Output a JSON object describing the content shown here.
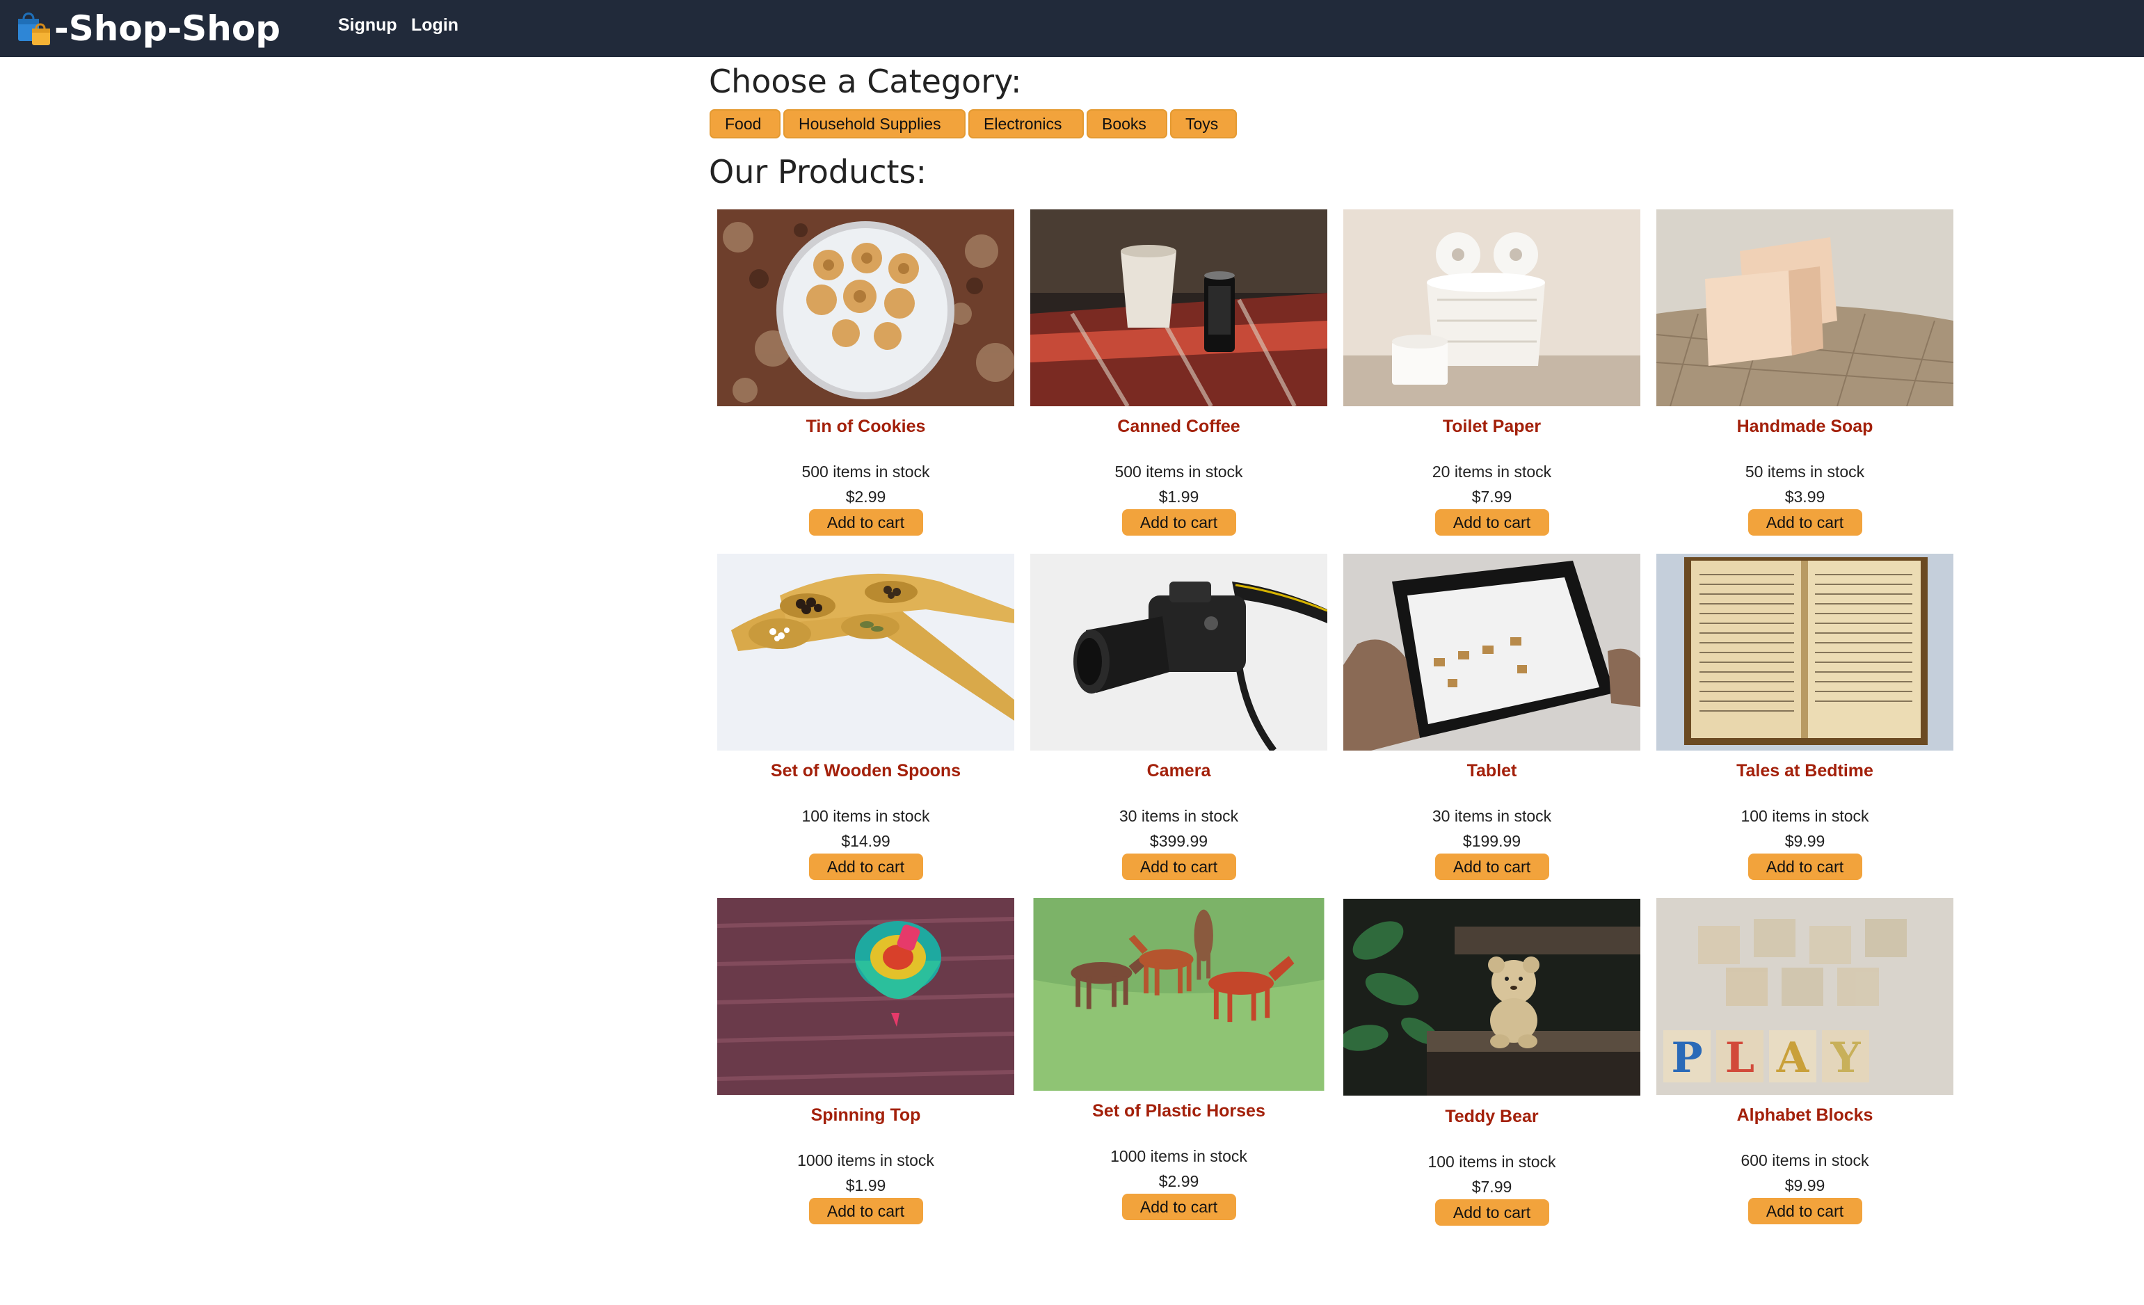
{
  "brand": {
    "name": "-Shop-Shop",
    "icon": "shopping-bags-icon"
  },
  "nav": {
    "signup": "Signup",
    "login": "Login"
  },
  "headings": {
    "categories": "Choose a Category:",
    "products": "Our Products:"
  },
  "categories": [
    "Food",
    "Household Supplies",
    "Electronics",
    "Books",
    "Toys"
  ],
  "colors": {
    "navbar": "#212a3a",
    "accent": "#f2a33c",
    "product_name": "#a3200a"
  },
  "add_to_cart_label": "Add to cart",
  "products": [
    {
      "name": "Tin of Cookies",
      "stock": "500 items in stock",
      "price": "$2.99",
      "image": "cookie-tin-photo"
    },
    {
      "name": "Canned Coffee",
      "stock": "500 items in stock",
      "price": "$1.99",
      "image": "canned-coffee-photo"
    },
    {
      "name": "Toilet Paper",
      "stock": "20 items in stock",
      "price": "$7.99",
      "image": "toilet-paper-photo"
    },
    {
      "name": "Handmade Soap",
      "stock": "50 items in stock",
      "price": "$3.99",
      "image": "soap-photo"
    },
    {
      "name": "Set of Wooden Spoons",
      "stock": "100 items in stock",
      "price": "$14.99",
      "image": "wooden-spoons-photo"
    },
    {
      "name": "Camera",
      "stock": "30 items in stock",
      "price": "$399.99",
      "image": "camera-photo"
    },
    {
      "name": "Tablet",
      "stock": "30 items in stock",
      "price": "$199.99",
      "image": "tablet-photo"
    },
    {
      "name": "Tales at Bedtime",
      "stock": "100 items in stock",
      "price": "$9.99",
      "image": "open-book-photo"
    },
    {
      "name": "Spinning Top",
      "stock": "1000 items in stock",
      "price": "$1.99",
      "image": "spinning-top-photo"
    },
    {
      "name": "Set of Plastic Horses",
      "stock": "1000 items in stock",
      "price": "$2.99",
      "image": "plastic-horses-photo"
    },
    {
      "name": "Teddy Bear",
      "stock": "100 items in stock",
      "price": "$7.99",
      "image": "teddy-bear-photo"
    },
    {
      "name": "Alphabet Blocks",
      "stock": "600 items in stock",
      "price": "$9.99",
      "image": "alphabet-blocks-photo"
    }
  ]
}
